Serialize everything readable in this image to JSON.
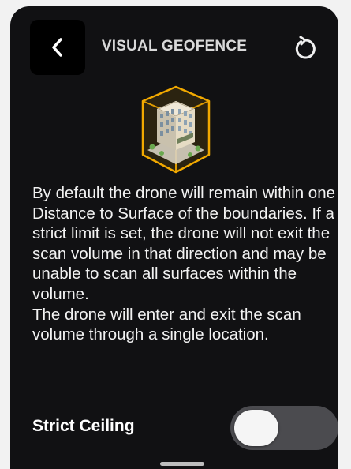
{
  "header": {
    "title": "VISUAL GEOFENCE",
    "back_icon": "chevron-left-icon",
    "reset_icon": "reset-icon"
  },
  "illustration": {
    "icon": "building-in-geofence-icon",
    "accent_color": "#f2a900"
  },
  "description": {
    "paragraph_1": "By default the drone will remain within one Distance to Surface of the boundaries. If a strict limit is set, the drone will not exit the scan volume in that direction and may be unable to scan all surfaces within the volume.",
    "paragraph_2": "The drone will enter and exit the scan volume through a single location."
  },
  "strict_ceiling": {
    "label": "Strict Ceiling",
    "enabled": false
  },
  "colors": {
    "panel_background": "#111113",
    "text": "#f2f2f2",
    "toggle_track": "#4b4b4f",
    "toggle_knob": "#f5f5f5"
  }
}
